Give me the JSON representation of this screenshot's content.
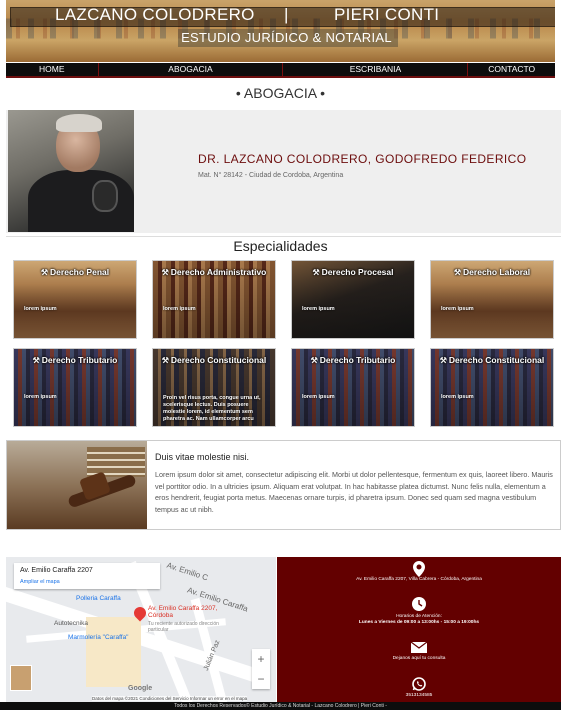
{
  "header": {
    "name_left": "LAZCANO COLODRERO",
    "separator": "|",
    "name_right": "PIERI CONTI",
    "subtitle": "ESTUDIO JURÍDICO & NOTARIAL"
  },
  "nav": [
    "HOME",
    "ABOGACIA",
    "ESCRIBANIA",
    "CONTACTO"
  ],
  "page_title": "• ABOGACIA •",
  "profile": {
    "name": "DR. LAZCANO COLODRERO, GODOFREDO FEDERICO",
    "mat": "Mat. N° 28142 - Ciudad de Cordoba, Argentina"
  },
  "specialties_title": "Especialidades",
  "cards": [
    {
      "title": "Derecho Penal",
      "desc": "lorem ipsum",
      "icon": "gavel-icon"
    },
    {
      "title": "Derecho Administrativo",
      "desc": "lorem ipsum",
      "icon": "gavel-icon"
    },
    {
      "title": "Derecho Procesal",
      "desc": "lorem ipsum",
      "icon": "gavel-icon"
    },
    {
      "title": "Derecho Laboral",
      "desc": "lorem ipsum",
      "icon": "gavel-icon"
    },
    {
      "title": "Derecho Tributario",
      "desc": "lorem ipsum",
      "icon": "gavel-icon"
    },
    {
      "title": "Derecho Constitucional",
      "desc": "Proin vel risus porta, congue urna ut, scelerisque lectus. Duis posuere molestie lorem, id elementum sem pharetra ac. Nam ullamcorper arcu",
      "icon": "gavel-icon"
    },
    {
      "title": "Derecho Tributario",
      "desc": "lorem ipsum",
      "icon": "gavel-icon"
    },
    {
      "title": "Derecho Constitucional",
      "desc": "lorem ipsum",
      "icon": "gavel-icon"
    }
  ],
  "info": {
    "heading": "Duis vitae molestie nisi.",
    "body": "Lorem ipsum dolor sit amet, consectetur adipiscing elit. Morbi ut dolor pellentesque, fermentum ex quis, laoreet libero. Mauris vel porttitor odio. In a ultricies ipsum. Aliquam erat volutpat. In hac habitasse platea dictumst. Nunc felis nulla, elementum a eros hendrerit, feugiat porta metus. Maecenas ornare turpis, id pharetra ipsum. Donec sed quam sed magna vestibulum tempus ac ut nibh."
  },
  "map": {
    "address": "Av. Emilio Caraffa 2207",
    "link": "Ampliar el mapa",
    "labels": {
      "street_top": "Av. Emilio C",
      "street_bottom": "Av. Emilio Caraffa",
      "polleria": "Polleria Caraffa",
      "autotecnika": "Autotecnika",
      "marmoleria": "Marmolería \"Caraffa\"",
      "pin": "Av. Emilio Caraffa 2207, Córdoba",
      "pin_sub": "Tu reciente autorizado dirección particular",
      "julian": "Julián Paz",
      "google": "Google"
    },
    "footer": "Datos del mapa ©2021   Condiciones del Servicio   Informar un error en el mapa"
  },
  "contact": {
    "address": "Av. Emilio Caraffa 2207, Villa Cabrera - Córdoba, Argentina",
    "hours_title": "Horarios de Atención:",
    "hours": "Lunes a Viernes de 09:00 a 13:00hs - 15:00 a 19:00hs",
    "email_label": "Dejanos aquí tu consulta",
    "phone": "3513134585"
  },
  "footer": "Todos los Derechos Reservados© Estudio Jurídico & Notarial - Lazcano Colodrero | Pieri Conti -"
}
